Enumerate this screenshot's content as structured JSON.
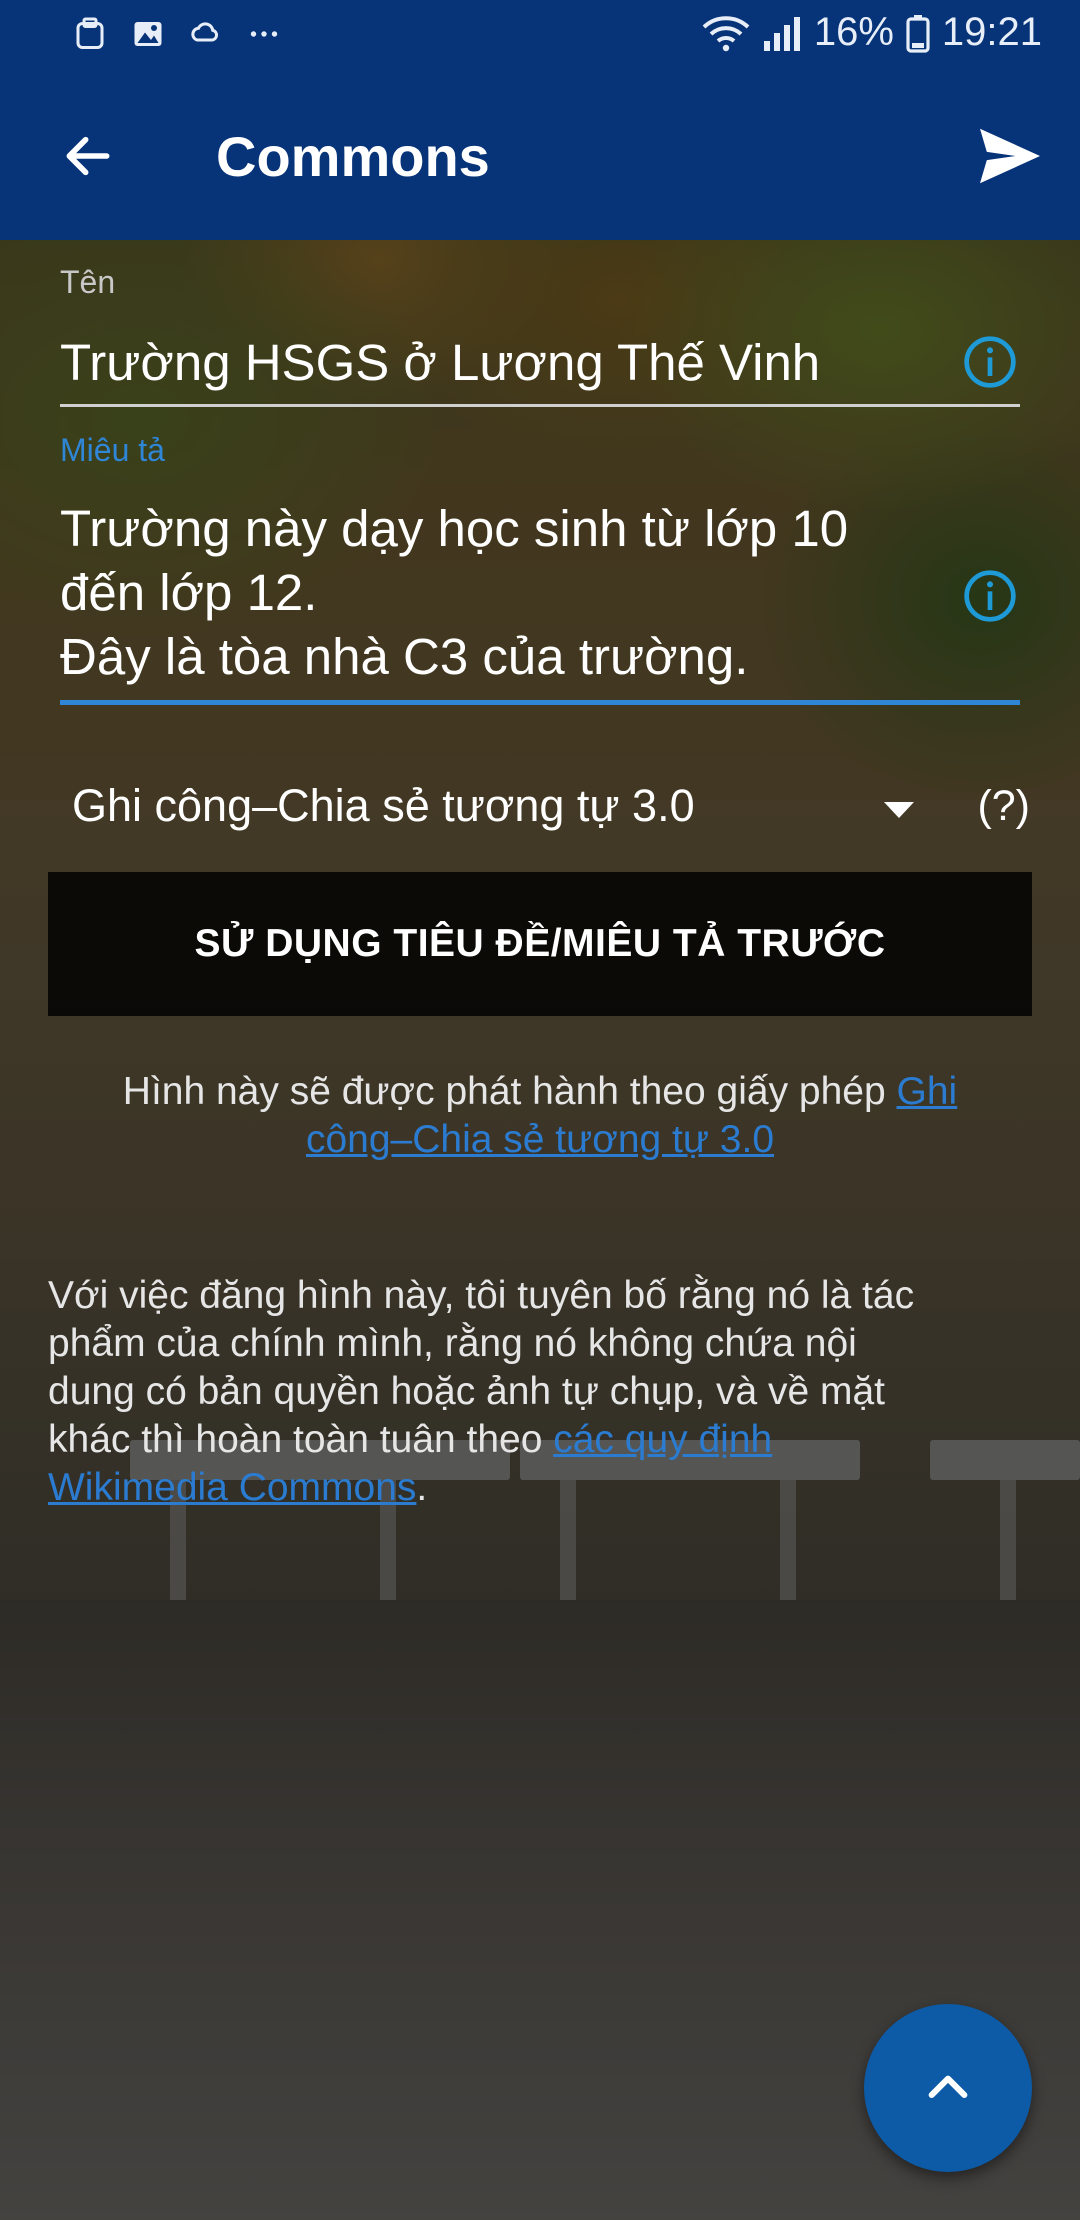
{
  "status_bar": {
    "left_icons": [
      "clipboard-icon",
      "gallery-icon",
      "weather-icon",
      "more-dots-icon"
    ],
    "battery": "16%",
    "time": "19:21"
  },
  "app_bar": {
    "title": "Commons",
    "back_icon": "arrow-back-icon",
    "send_icon": "send-icon",
    "color": "#073478"
  },
  "form": {
    "title_label": "Tên",
    "title_value": "Trường HSGS ở Lương Thế Vinh",
    "description_label": "Miêu tả",
    "description_value": "Trường này dạy học sinh từ lớp 10\nđến lớp 12.\nĐây là tòa nhà C3 của trường.",
    "license_selected": "Ghi công–Chia sẻ tương tự 3.0",
    "license_help": "(?)",
    "use_previous_button": "SỬ DỤNG TIÊU ĐỀ/MIÊU TẢ TRƯỚC"
  },
  "license_note": {
    "text": "Hình này sẽ được phát hành theo giấy phép ",
    "link": "Ghi công–Chia sẻ tương tự 3.0"
  },
  "declaration": {
    "text": "Với việc đăng hình này, tôi tuyên bố rằng nó là tác phẩm của chính mình, rằng nó không chứa nội dung có bản quyền hoặc ảnh tự chụp, và về mặt khác thì hoàn toàn tuân theo ",
    "link": "các quy định Wikimedia Commons",
    "end": "."
  },
  "fab": {
    "icon": "chevron-up-icon"
  },
  "colors": {
    "accent": "#2f86d6",
    "info_icon": "#1e9ad6",
    "fab": "#0d5aa6"
  }
}
